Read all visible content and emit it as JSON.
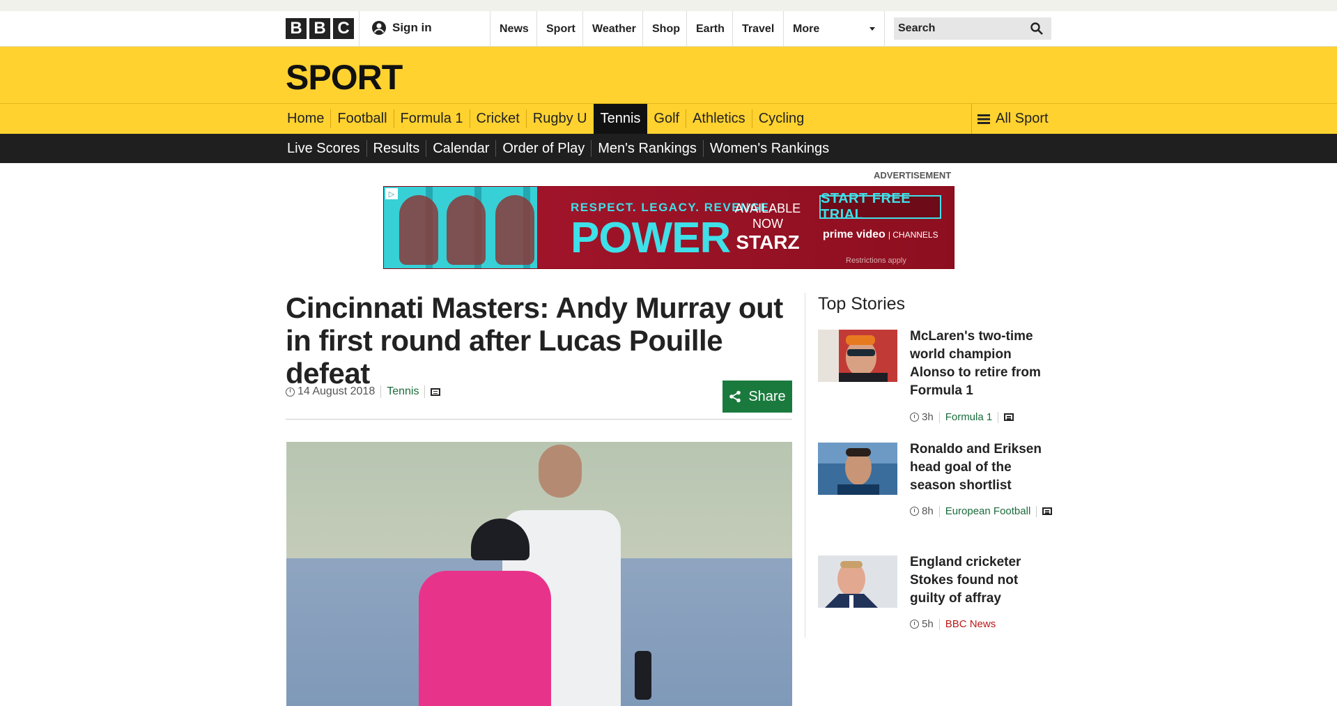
{
  "global_nav": {
    "logo_letters": [
      "B",
      "B",
      "C"
    ],
    "sign_in": "Sign in",
    "items": [
      "News",
      "Sport",
      "Weather",
      "Shop",
      "Earth",
      "Travel"
    ],
    "more": "More",
    "search_placeholder": "Search"
  },
  "sport_header": {
    "title": "SPORT",
    "brand_color": "#ffd230"
  },
  "sport_nav": {
    "items": [
      "Home",
      "Football",
      "Formula 1",
      "Cricket",
      "Rugby U",
      "Tennis",
      "Golf",
      "Athletics",
      "Cycling"
    ],
    "active": "Tennis",
    "all_sport": "All Sport"
  },
  "tennis_nav": {
    "items": [
      "Live Scores",
      "Results",
      "Calendar",
      "Order of Play",
      "Men's Rankings",
      "Women's Rankings"
    ]
  },
  "advert": {
    "label": "ADVERTISEMENT",
    "tagline": "RESPECT. LEGACY. REVENGE.",
    "brand": "POWER",
    "availability": [
      "AVAILABLE",
      "NOW",
      "STARZ"
    ],
    "cta": "START FREE TRIAL",
    "partner": "prime video",
    "partner_channels": "| CHANNELS",
    "restrictions": "Restrictions apply"
  },
  "article": {
    "headline": "Cincinnati Masters: Andy Murray out in first round after Lucas Pouille defeat",
    "date": "14 August 2018",
    "section": "Tennis",
    "share_label": "Share"
  },
  "top_stories": {
    "title": "Top Stories",
    "items": [
      {
        "title": "McLaren's two-time world champion Alonso to retire from Formula 1",
        "time": "3h",
        "section": "Formula 1"
      },
      {
        "title": "Ronaldo and Eriksen head goal of the season shortlist",
        "time": "8h",
        "section": "European Football"
      },
      {
        "title": "England cricketer Stokes found not guilty of affray",
        "time": "5h",
        "section": "BBC News"
      }
    ]
  },
  "colors": {
    "accent_green": "#1a7a3d",
    "section_green": "#1a6b3a",
    "news_red": "#bb1919",
    "sub_nav_dark": "#1f1f1f"
  },
  "icons": [
    "user-icon",
    "search-icon",
    "dropdown-caret-icon",
    "menu-icon",
    "clock-icon",
    "comment-icon",
    "share-icon",
    "adchoices-icon"
  ]
}
